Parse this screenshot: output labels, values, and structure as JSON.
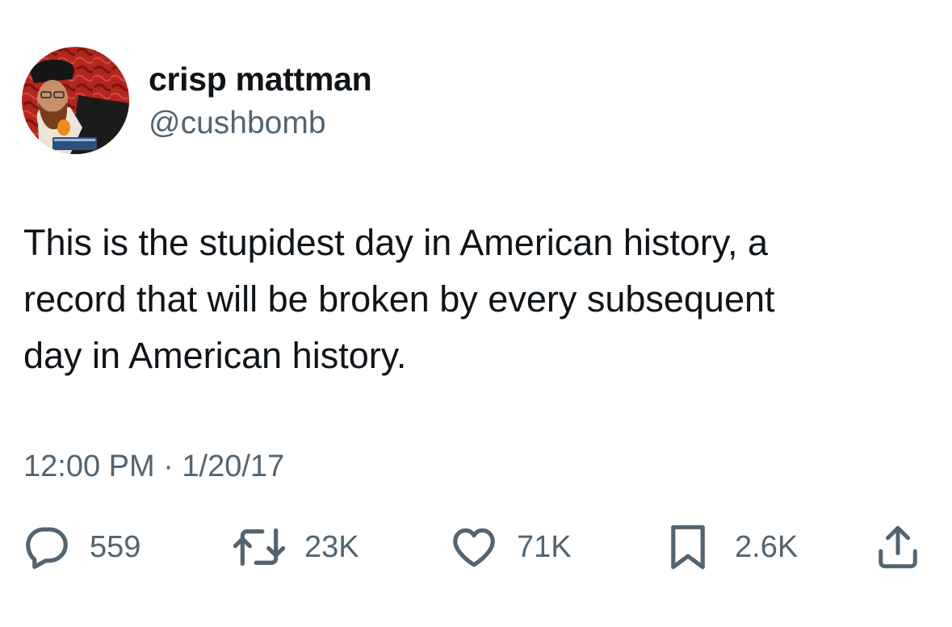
{
  "tweet": {
    "author": {
      "display_name": "crisp mattman",
      "handle": "@cushbomb"
    },
    "text_lines": [
      "This is the stupidest day in American history, a",
      "record that will be broken by every subsequent",
      "day in American history."
    ],
    "timestamp": "12:00 PM · 1/20/17",
    "actions": {
      "reply": {
        "icon": "reply-icon",
        "count": "559"
      },
      "retweet": {
        "icon": "retweet-icon",
        "count": "23K"
      },
      "like": {
        "icon": "heart-icon",
        "count": "71K"
      },
      "bookmark": {
        "icon": "bookmark-icon",
        "count": "2.6K"
      },
      "share": {
        "icon": "share-icon"
      }
    }
  },
  "colors": {
    "text_primary": "#0f1419",
    "text_secondary": "#536471",
    "avatar_background": "#b3261e"
  }
}
